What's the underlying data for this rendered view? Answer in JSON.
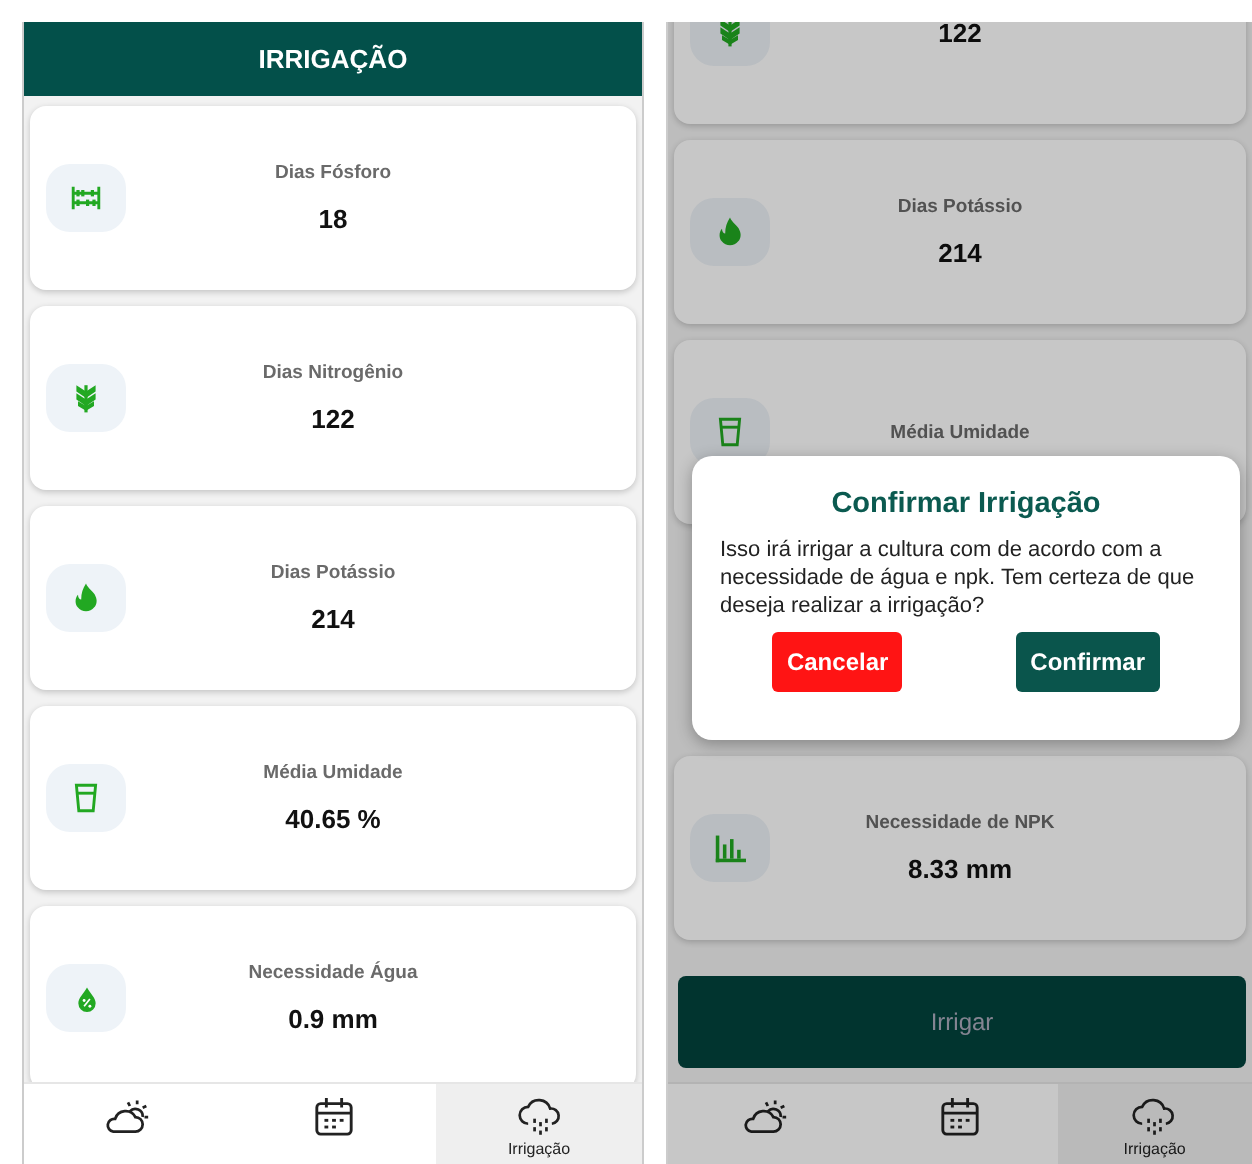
{
  "screens": [
    {
      "header": {
        "title": "IRRIGAÇÃO"
      },
      "cards": [
        {
          "kind": "abacus",
          "label": "Dias Fósforo",
          "value": "18"
        },
        {
          "kind": "wheat",
          "label": "Dias Nitrogênio",
          "value": "122"
        },
        {
          "kind": "flame",
          "label": "Dias Potássio",
          "value": "214"
        },
        {
          "kind": "cup",
          "label": "Média Umidade",
          "value": "40.65 %"
        },
        {
          "kind": "drop",
          "label": "Necessidade Água",
          "value": "0.9 mm"
        }
      ],
      "nav": [
        {
          "kind": "weather",
          "selected": false
        },
        {
          "kind": "calendar",
          "selected": false
        },
        {
          "kind": "rain",
          "label": "Irrigação",
          "selected": true
        }
      ]
    },
    {
      "cards": [
        {
          "kind": "wheat",
          "value": "122"
        },
        {
          "kind": "flame",
          "label": "Dias Potássio",
          "value": "214"
        },
        {
          "kind": "cup",
          "label": "Média Umidade"
        },
        {
          "kind": "chart",
          "label": "Necessidade de NPK",
          "value": "8.33 mm"
        }
      ],
      "action_button": {
        "label": "Irrigar",
        "disabled": true
      },
      "nav": [
        {
          "kind": "weather",
          "selected": false
        },
        {
          "kind": "calendar",
          "selected": false
        },
        {
          "kind": "rain",
          "label": "Irrigação",
          "selected": true
        }
      ],
      "dialog": {
        "title": "Confirmar Irrigação",
        "message": "Isso irá irrigar a cultura com de acordo com a necessidade de água e npk. Tem certeza de que deseja realizar a irrigação?",
        "buttons": [
          {
            "label": "Cancelar",
            "kind": "cancel"
          },
          {
            "label": "Confirmar",
            "kind": "confirm"
          }
        ]
      }
    }
  ]
}
